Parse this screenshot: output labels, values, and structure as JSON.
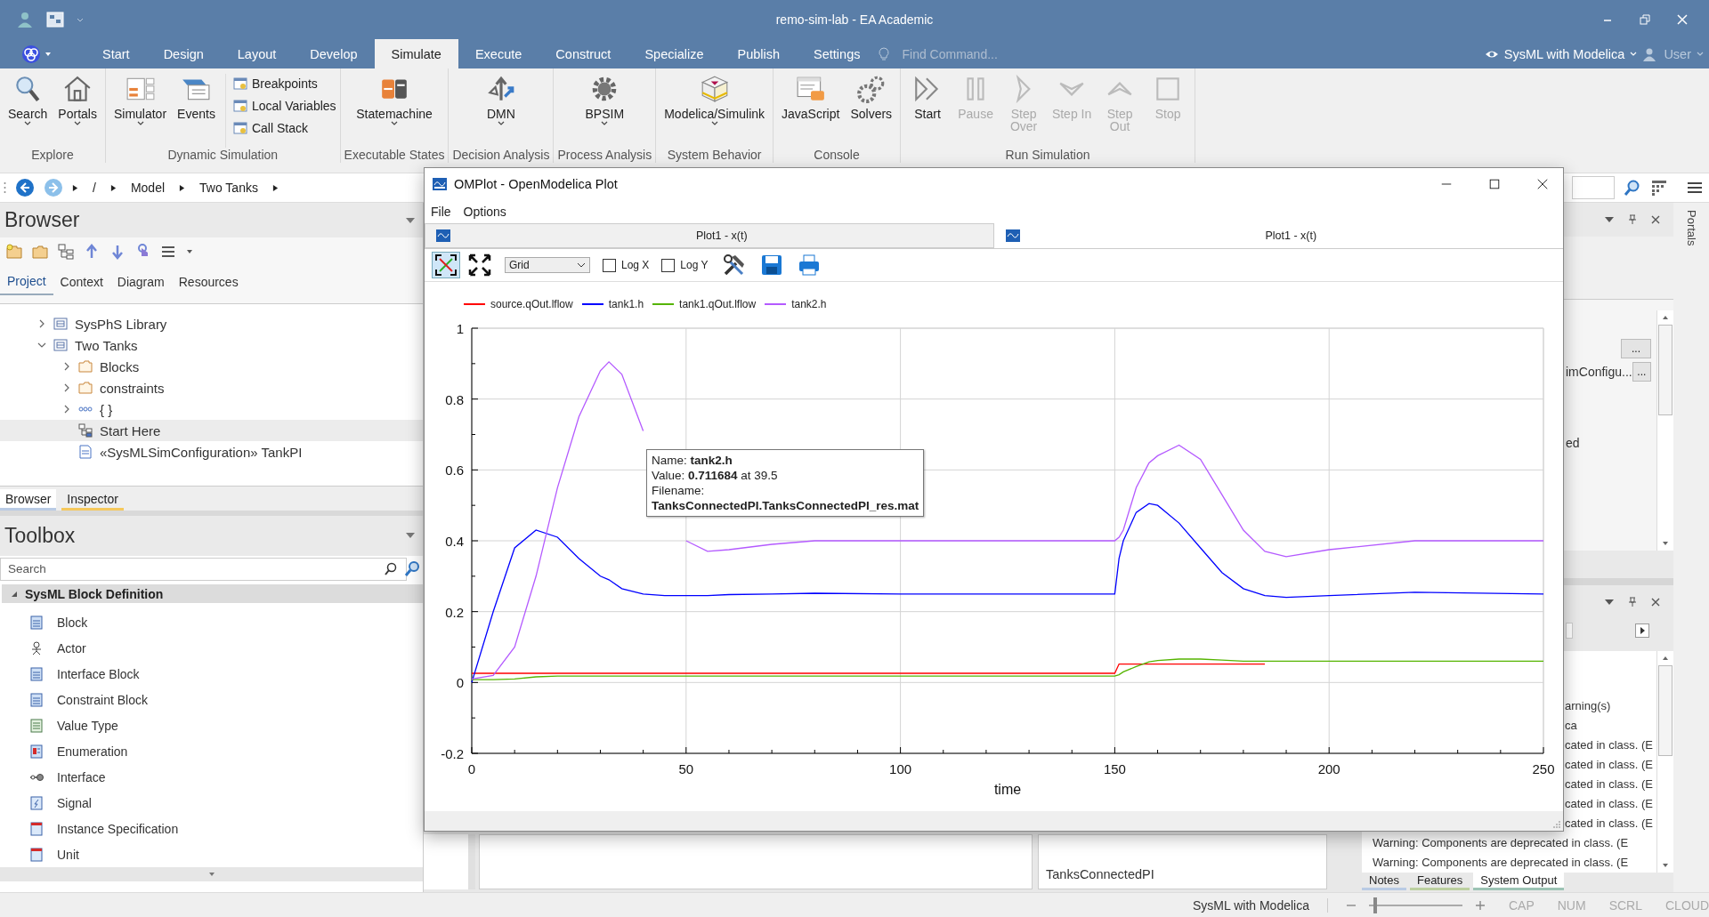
{
  "app": {
    "title": "remo-sim-lab - EA Academic"
  },
  "ribbon_tabs": [
    {
      "label": "Start",
      "selected": false
    },
    {
      "label": "Design",
      "selected": false
    },
    {
      "label": "Layout",
      "selected": false
    },
    {
      "label": "Develop",
      "selected": false
    },
    {
      "label": "Simulate",
      "selected": true
    },
    {
      "label": "Execute",
      "selected": false
    },
    {
      "label": "Construct",
      "selected": false
    },
    {
      "label": "Specialize",
      "selected": false
    },
    {
      "label": "Publish",
      "selected": false
    },
    {
      "label": "Settings",
      "selected": false
    }
  ],
  "find_command": {
    "placeholder": "Find Command..."
  },
  "perspective": "SysML with Modelica",
  "user": "User",
  "ribbon_groups": [
    {
      "label": "Explore",
      "buttons": [
        {
          "label": "Search",
          "dropdown": true,
          "disabled": false
        },
        {
          "label": "Portals",
          "dropdown": true,
          "disabled": false
        }
      ]
    },
    {
      "label": "Dynamic Simulation",
      "buttons": [
        {
          "label": "Simulator",
          "dropdown": true,
          "disabled": false
        },
        {
          "label": "Events",
          "dropdown": false,
          "disabled": false
        }
      ],
      "small_buttons": [
        "Breakpoints",
        "Local Variables",
        "Call Stack"
      ]
    },
    {
      "label": "Executable States",
      "buttons": [
        {
          "label": "Statemachine",
          "dropdown": true,
          "disabled": false
        }
      ]
    },
    {
      "label": "Decision Analysis",
      "buttons": [
        {
          "label": "DMN",
          "dropdown": true,
          "disabled": false
        }
      ]
    },
    {
      "label": "Process Analysis",
      "buttons": [
        {
          "label": "BPSIM",
          "dropdown": true,
          "disabled": false
        }
      ]
    },
    {
      "label": "System Behavior",
      "buttons": [
        {
          "label": "Modelica/Simulink",
          "dropdown": true,
          "disabled": false
        }
      ]
    },
    {
      "label": "Console",
      "buttons": [
        {
          "label": "JavaScript",
          "dropdown": false,
          "disabled": false
        },
        {
          "label": "Solvers",
          "dropdown": false,
          "disabled": false
        }
      ]
    },
    {
      "label": "Run Simulation",
      "buttons": [
        {
          "label": "Start",
          "dropdown": false,
          "disabled": false
        },
        {
          "label": "Pause",
          "dropdown": false,
          "disabled": true
        },
        {
          "label": "Step Over",
          "dropdown": false,
          "disabled": true
        },
        {
          "label": "Step In",
          "dropdown": false,
          "disabled": true
        },
        {
          "label": "Step Out",
          "dropdown": false,
          "disabled": true
        },
        {
          "label": "Stop",
          "dropdown": false,
          "disabled": true
        }
      ]
    }
  ],
  "breadcrumb": [
    "/",
    "Model",
    "Two Tanks"
  ],
  "browser": {
    "title": "Browser",
    "tabs": [
      {
        "label": "Project",
        "selected": true
      },
      {
        "label": "Context",
        "selected": false
      },
      {
        "label": "Diagram",
        "selected": false
      },
      {
        "label": "Resources",
        "selected": false
      }
    ],
    "tree": [
      {
        "label": "SysPhS Library",
        "kind": "package",
        "expanded": false,
        "selected": false
      },
      {
        "label": "Two Tanks",
        "kind": "package",
        "expanded": true,
        "selected": false,
        "children": [
          {
            "label": "Blocks",
            "kind": "folder",
            "expanded": false,
            "selected": false
          },
          {
            "label": "constraints",
            "kind": "folder",
            "expanded": false,
            "selected": false
          },
          {
            "label": "{ }",
            "kind": "group",
            "expanded": false,
            "selected": false
          },
          {
            "label": "Start Here",
            "kind": "diagram",
            "selected": true
          },
          {
            "label": "«SysMLSimConfiguration» TankPI",
            "kind": "document",
            "selected": false
          }
        ]
      }
    ],
    "bottom_tabs": [
      {
        "label": "Browser",
        "selected": true
      },
      {
        "label": "Inspector",
        "selected": false
      }
    ]
  },
  "toolbox": {
    "title": "Toolbox",
    "search": {
      "placeholder": "Search"
    },
    "section": {
      "label": "SysML Block Definition",
      "expanded": true,
      "items": [
        "Block",
        "Actor",
        "Interface Block",
        "Constraint Block",
        "Value Type",
        "Enumeration",
        "Interface",
        "Signal",
        "Instance Specification",
        "Unit"
      ]
    }
  },
  "properties_panel": {
    "rows": [
      {
        "button": "..."
      },
      {
        "value": "imConfigu...",
        "button": "..."
      },
      {
        "value": "ed"
      }
    ]
  },
  "model_list": [
    "TanksConnectedPI"
  ],
  "output_panel": {
    "lines": [
      {
        "text": "arning(s)",
        "kind": "covered"
      },
      {
        "text": "ca",
        "kind": "covered"
      },
      {
        "text": "cated in class. (E",
        "kind": "covered"
      },
      {
        "text": "cated in class. (E",
        "kind": "covered"
      },
      {
        "text": "cated in class. (E",
        "kind": "covered"
      },
      {
        "text": "cated in class. (E",
        "kind": "covered"
      },
      {
        "text": "cated in class. (E",
        "kind": "covered"
      },
      {
        "text": "Warning: Components are deprecated in class. (E",
        "kind": "full"
      },
      {
        "text": "Warning: Components are deprecated in class. (E",
        "kind": "full"
      }
    ],
    "tabs": [
      {
        "label": "Notes",
        "selected": false
      },
      {
        "label": "Features",
        "selected": false
      },
      {
        "label": "System Output",
        "selected": true
      }
    ]
  },
  "portals_label": "Portals",
  "status_bar": {
    "perspective": "SysML with Modelica",
    "zoom": {
      "level": 0.05
    },
    "indicators": [
      {
        "label": "CAP",
        "on": false
      },
      {
        "label": "NUM",
        "on": false
      },
      {
        "label": "SCRL",
        "on": false
      },
      {
        "label": "CLOUD",
        "on": false
      }
    ]
  },
  "plot_window": {
    "title": "OMPlot - OpenModelica Plot",
    "menu": [
      "File",
      "Options"
    ],
    "tabs": [
      {
        "label": "Plot1 - x(t)",
        "selected": false
      },
      {
        "label": "Plot1 - x(t)",
        "selected": true
      }
    ],
    "grid_mode": "Grid",
    "log_options": [
      {
        "label": "Log X",
        "checked": false
      },
      {
        "label": "Log Y",
        "checked": false
      }
    ],
    "chart_data": {
      "type": "line",
      "xlabel": "time",
      "x": [
        0,
        5,
        10,
        15,
        20,
        25,
        30,
        32,
        35,
        40,
        45,
        50,
        55,
        60,
        70,
        80,
        100,
        150,
        151,
        152,
        155,
        158,
        160,
        165,
        170,
        175,
        180,
        185,
        190,
        200,
        220,
        250
      ],
      "series": [
        {
          "name": "source.qOut.lflow",
          "color": "#ff0000",
          "values": [
            0.026,
            0.026,
            0.026,
            0.026,
            0.026,
            0.026,
            0.026,
            0.026,
            0.026,
            0.026,
            0.026,
            0.026,
            0.026,
            0.026,
            0.026,
            0.026,
            0.026,
            0.026,
            0.052,
            0.052,
            0.052,
            0.052,
            0.052,
            0.052,
            0.052,
            0.052,
            0.052,
            0.052,
            null,
            null,
            null,
            null
          ]
        },
        {
          "name": "tank1.h",
          "color": "#0000ff",
          "values": [
            0,
            0.2,
            0.38,
            0.43,
            0.41,
            0.35,
            0.3,
            0.29,
            0.265,
            0.25,
            0.245,
            0.245,
            0.245,
            0.248,
            0.25,
            0.252,
            0.25,
            0.25,
            0.35,
            0.4,
            0.48,
            0.505,
            0.5,
            0.45,
            0.38,
            0.31,
            0.265,
            0.245,
            0.24,
            0.245,
            0.255,
            0.25
          ]
        },
        {
          "name": "tank1.qOut.lflow",
          "color": "#55b400",
          "values": [
            0.008,
            0.008,
            0.01,
            0.016,
            0.018,
            0.018,
            0.018,
            0.018,
            0.018,
            0.018,
            0.018,
            0.018,
            0.018,
            0.018,
            0.018,
            0.018,
            0.018,
            0.018,
            0.022,
            0.03,
            0.045,
            0.058,
            0.062,
            0.066,
            0.066,
            0.063,
            0.06,
            0.06,
            0.06,
            0.06,
            0.06,
            0.06
          ]
        },
        {
          "name": "tank2.h",
          "color": "#b45aff",
          "values": [
            0.01,
            0.02,
            0.1,
            0.3,
            0.55,
            0.75,
            0.88,
            0.905,
            0.87,
            0.71,
            null,
            0.4,
            0.37,
            0.375,
            0.39,
            0.4,
            0.4,
            0.4,
            0.41,
            0.43,
            0.55,
            0.62,
            0.64,
            0.67,
            0.63,
            0.53,
            0.43,
            0.37,
            0.355,
            0.375,
            0.4,
            0.4
          ]
        }
      ],
      "xlim": [
        0,
        250
      ],
      "ylim": [
        -0.2,
        1
      ],
      "grid": true,
      "legend": true,
      "xticks": [
        0,
        50,
        100,
        150,
        200,
        250
      ],
      "yticks": [
        -0.2,
        0,
        0.2,
        0.4,
        0.6,
        0.8,
        1
      ]
    },
    "tooltip": {
      "name_line": "Name: **tank2.h**",
      "value_line": "Value: **0.711684** at 39.5",
      "filename_label": "Filename:",
      "filename": "TanksConnectedPI.TanksConnectedPI_res.mat"
    }
  }
}
